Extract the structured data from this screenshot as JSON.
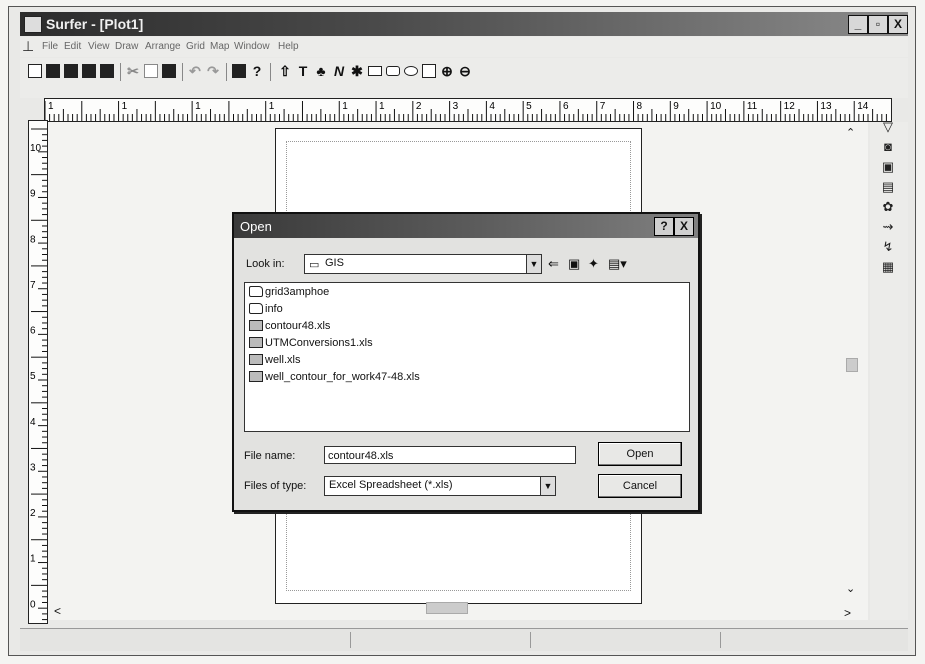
{
  "window": {
    "title": "Surfer - [Plot1]",
    "minimize": "_",
    "maximize": "▫",
    "close": "X"
  },
  "menu": [
    "File",
    "Edit",
    "View",
    "Draw",
    "Arrange",
    "Grid",
    "Map",
    "Window",
    "Help"
  ],
  "ruler": {
    "horizontal": [
      "1",
      "",
      "1",
      "",
      "1",
      "",
      "1",
      "",
      "1",
      "1",
      "2",
      "3",
      "4",
      "5",
      "6",
      "7",
      "8",
      "9",
      "10",
      "11",
      "12",
      "13",
      "14"
    ],
    "vertical": [
      "10",
      "9",
      "8",
      "7",
      "6",
      "5",
      "4",
      "3",
      "2",
      "1",
      "0"
    ]
  },
  "dialog": {
    "title": "Open",
    "help": "?",
    "close": "X",
    "look_in_label": "Look in:",
    "look_in_value": "GIS",
    "files": [
      {
        "name": "grid3amphoe",
        "type": "folder"
      },
      {
        "name": "info",
        "type": "folder"
      },
      {
        "name": "contour48.xls",
        "type": "xls"
      },
      {
        "name": "UTMConversions1.xls",
        "type": "xls"
      },
      {
        "name": "well.xls",
        "type": "xls"
      },
      {
        "name": "well_contour_for_work47-48.xls",
        "type": "xls"
      }
    ],
    "file_name_label": "File name:",
    "file_name_value": "contour48.xls",
    "file_type_label": "Files of type:",
    "file_type_value": "Excel Spreadsheet (*.xls)",
    "open_button": "Open",
    "cancel_button": "Cancel"
  }
}
